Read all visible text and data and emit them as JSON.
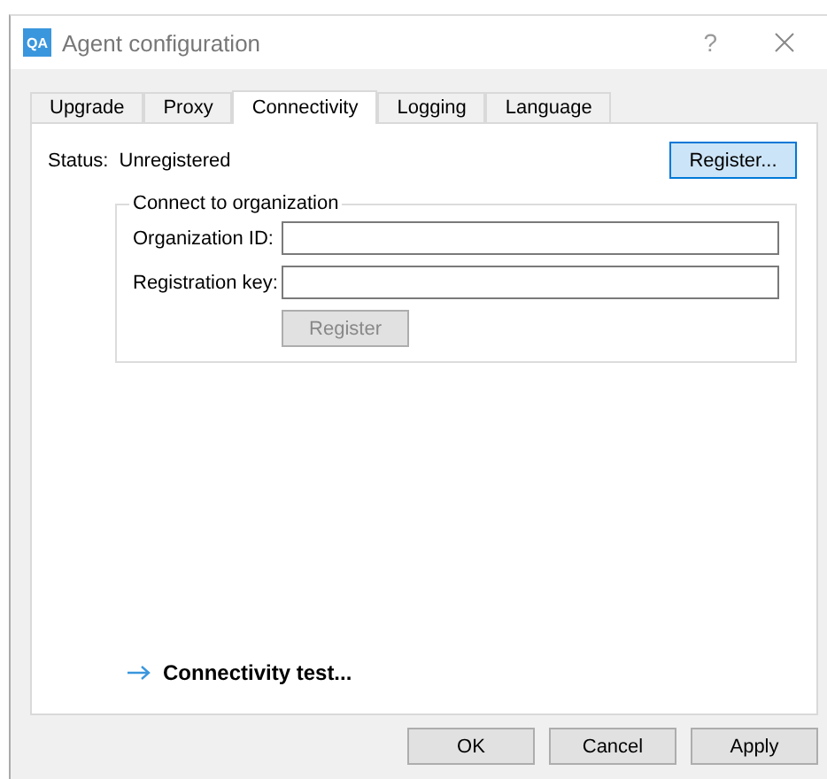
{
  "window": {
    "logo": "QA",
    "title": "Agent configuration",
    "help": "?"
  },
  "tabs": [
    {
      "label": "Upgrade",
      "selected": false
    },
    {
      "label": "Proxy",
      "selected": false
    },
    {
      "label": "Connectivity",
      "selected": true
    },
    {
      "label": "Logging",
      "selected": false
    },
    {
      "label": "Language",
      "selected": false
    }
  ],
  "status": {
    "label": "Status:",
    "value": "Unregistered",
    "button": "Register..."
  },
  "group": {
    "title": "Connect to organization",
    "fields": [
      {
        "label": "Organization ID:"
      },
      {
        "label": "Registration key:"
      }
    ],
    "button": {
      "label": "Register",
      "disabled": true
    }
  },
  "link": "Connectivity test...",
  "buttons": [
    "OK",
    "Cancel",
    "Apply"
  ]
}
